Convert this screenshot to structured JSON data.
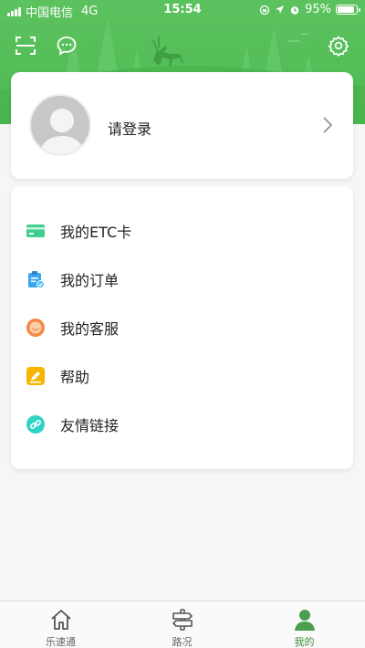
{
  "status_bar": {
    "carrier": "中国电信",
    "network": "4G",
    "time": "15:54",
    "battery_percent": "95%",
    "battery_level": 0.95
  },
  "header": {
    "scan_icon": "scan-icon",
    "message_icon": "chat-bubble-icon",
    "settings_icon": "gear-icon"
  },
  "profile": {
    "login_prompt": "请登录",
    "avatar_icon": "default-avatar-icon"
  },
  "menu": {
    "items": [
      {
        "label": "我的ETC卡",
        "icon": "etc-card-icon",
        "color": "#3ecf8e"
      },
      {
        "label": "我的订单",
        "icon": "order-clipboard-icon",
        "color": "#3aa6f0"
      },
      {
        "label": "我的客服",
        "icon": "customer-service-icon",
        "color": "#f5894a"
      },
      {
        "label": "帮助",
        "icon": "help-pencil-icon",
        "color": "#f7b500"
      },
      {
        "label": "友情链接",
        "icon": "link-icon",
        "color": "#2fd3c6"
      }
    ]
  },
  "tabbar": {
    "tabs": [
      {
        "label": "乐速通",
        "icon": "home-icon",
        "active": false
      },
      {
        "label": "路况",
        "icon": "road-signpost-icon",
        "active": false
      },
      {
        "label": "我的",
        "icon": "person-icon",
        "active": true
      }
    ]
  },
  "colors": {
    "brand_green": "#4dba52",
    "active_tab": "#3a8f3f"
  }
}
